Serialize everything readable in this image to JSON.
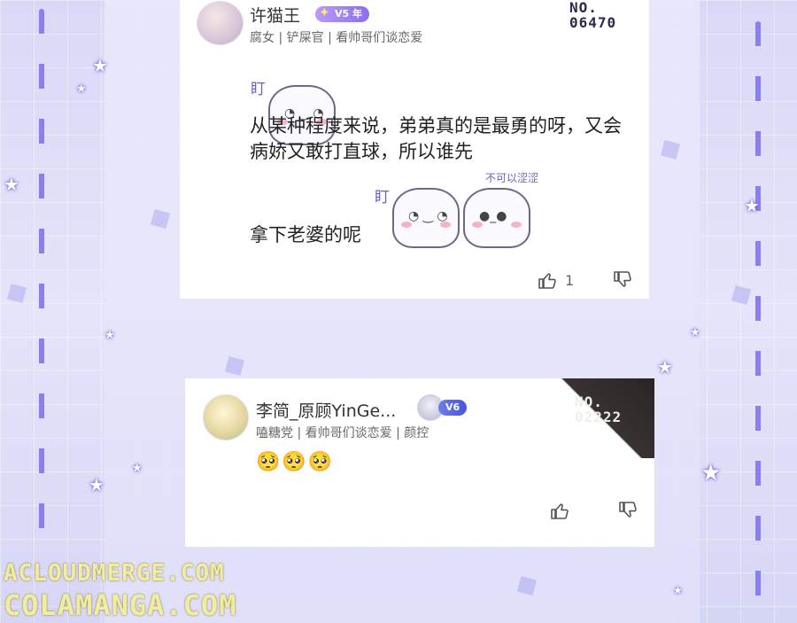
{
  "comments": [
    {
      "username": "许猫王",
      "vip_label": "V5 年",
      "tags": "腐女 | 铲屎官 | 看帅哥们谈恋爱",
      "badge_no": "NO.\n06470",
      "text_line_main": "从某种程度来说，弟弟真的是最勇的呀，又会病娇又敢打直球，所以谁先",
      "text_line_end": "拿下老婆的呢",
      "sticker_label_1": "盯",
      "sticker_label_2": "盯",
      "sticker_label_3": "不可以涩涩",
      "like_count": "1"
    },
    {
      "username": "李简_原顾YinGe...",
      "vip_label": "V6",
      "tags": "嗑糖党 | 看帅哥们谈恋爱 | 颜控",
      "badge_no": "NO.\n02222",
      "emoji_text": "🥺🥺🥺"
    }
  ],
  "watermark": {
    "line1": "ACLOUDMERGE.COM",
    "line2": "COLAMANGA.COM"
  },
  "colors": {
    "accent_dash": "#8b7ff0",
    "vip_purple": "#8e6cf0",
    "watermark": "#f0ee9c"
  }
}
